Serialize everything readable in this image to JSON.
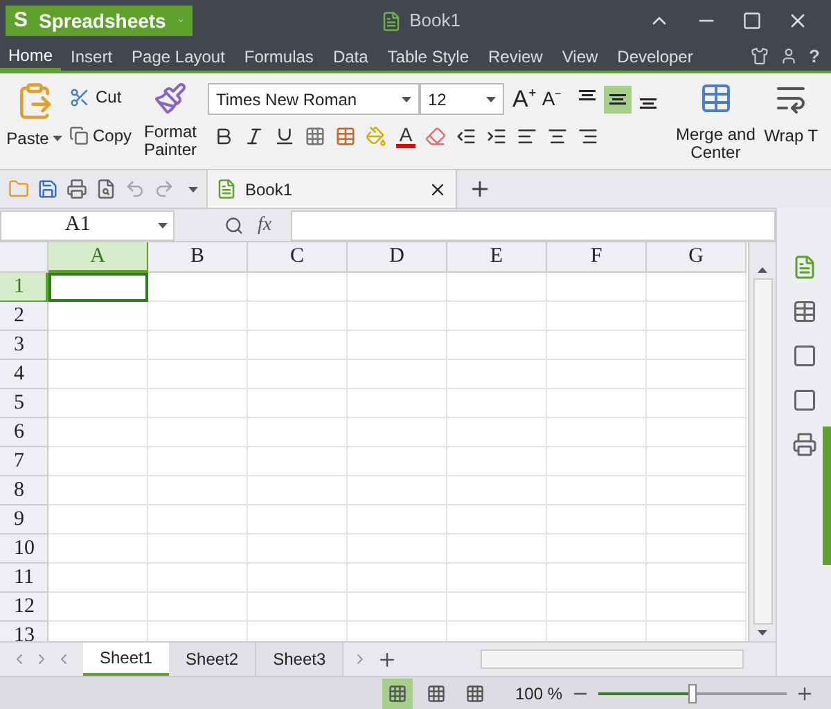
{
  "app_menu": {
    "logo": "S",
    "label": "Spreadsheets"
  },
  "help": "?",
  "window": {
    "title": "Book1"
  },
  "menu_tabs": [
    {
      "label": "Home",
      "selected": true
    },
    {
      "label": "Insert",
      "selected": false
    },
    {
      "label": "Page Layout",
      "selected": false
    },
    {
      "label": "Formulas",
      "selected": false
    },
    {
      "label": "Data",
      "selected": false
    },
    {
      "label": "Table Style",
      "selected": false
    },
    {
      "label": "Review",
      "selected": false
    },
    {
      "label": "View",
      "selected": false
    },
    {
      "label": "Developer",
      "selected": false
    }
  ],
  "ribbon": {
    "paste": "Paste",
    "cut": "Cut",
    "copy": "Copy",
    "format_painter": [
      "Format",
      "Painter"
    ],
    "font": "Times New Roman",
    "font_size": "12",
    "grow_font": "A⁺",
    "shrink_font": "A⁻",
    "font_color": "A",
    "vertical_align": [
      {
        "selected": false
      },
      {
        "selected": true
      },
      {
        "selected": false
      }
    ],
    "merge": [
      "Merge and",
      "Center"
    ],
    "wrap": "Wrap T"
  },
  "doc_tab": {
    "label": "Book1"
  },
  "name_box": "A1",
  "formula_label": "fx",
  "columns": [
    {
      "label": "A",
      "selected": true
    },
    {
      "label": "B",
      "selected": false
    },
    {
      "label": "C",
      "selected": false
    },
    {
      "label": "D",
      "selected": false
    },
    {
      "label": "E",
      "selected": false
    },
    {
      "label": "F",
      "selected": false
    },
    {
      "label": "G",
      "selected": false
    }
  ],
  "rows": [
    {
      "label": "1",
      "selected": true
    },
    {
      "label": "2",
      "selected": false
    },
    {
      "label": "3",
      "selected": false
    },
    {
      "label": "4",
      "selected": false
    },
    {
      "label": "5",
      "selected": false
    },
    {
      "label": "6",
      "selected": false
    },
    {
      "label": "7",
      "selected": false
    },
    {
      "label": "8",
      "selected": false
    },
    {
      "label": "9",
      "selected": false
    },
    {
      "label": "10",
      "selected": false
    },
    {
      "label": "11",
      "selected": false
    },
    {
      "label": "12",
      "selected": false
    },
    {
      "label": "13",
      "selected": false
    }
  ],
  "sheets": [
    {
      "label": "Sheet1",
      "selected": true
    },
    {
      "label": "Sheet2",
      "selected": false
    },
    {
      "label": "Sheet3",
      "selected": false
    }
  ],
  "status_bar": {
    "views": [
      {
        "selected": true
      },
      {
        "selected": false
      },
      {
        "selected": false
      }
    ],
    "zoom": "100 %",
    "zoom_slider": {
      "level": 0.5
    }
  }
}
